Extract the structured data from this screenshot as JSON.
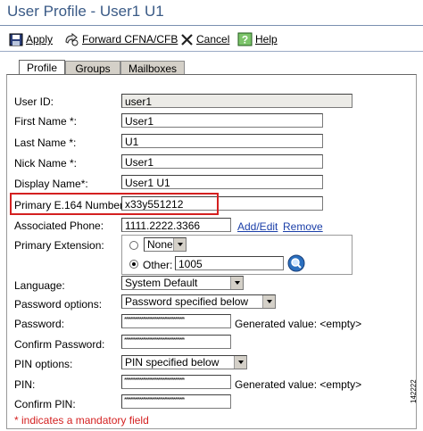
{
  "page": {
    "title": "User Profile - User1 U1"
  },
  "toolbar": {
    "apply": "Apply",
    "forward": "Forward CFNA/CFB",
    "cancel": "Cancel",
    "help": "Help"
  },
  "tabs": [
    "Profile",
    "Groups",
    "Mailboxes"
  ],
  "form": {
    "user_id": {
      "label": "User ID:",
      "value": "user1"
    },
    "first_name": {
      "label": "First Name *:",
      "value": "User1"
    },
    "last_name": {
      "label": "Last Name *:",
      "value": "U1"
    },
    "nick_name": {
      "label": "Nick Name *:",
      "value": "User1"
    },
    "display_name": {
      "label": "Display Name*:",
      "value": "User1 U1"
    },
    "primary_e164": {
      "label": "Primary E.164 Number:",
      "value": "x33y551212"
    },
    "associated_phone": {
      "label": "Associated Phone:",
      "value": "1111.2222.3366",
      "add_edit": "Add/Edit",
      "remove": "Remove"
    },
    "primary_extension": {
      "label": "Primary Extension:",
      "none_option": "None",
      "other_label": "Other:",
      "other_value": "1005"
    },
    "language": {
      "label": "Language:",
      "value": "System Default"
    },
    "password_options": {
      "label": "Password options:",
      "value": "Password specified below"
    },
    "password": {
      "label": "Password:",
      "mask": "***************************************",
      "generated": "Generated value: <empty>"
    },
    "confirm_password": {
      "label": "Confirm Password:",
      "mask": "***************************************"
    },
    "pin_options": {
      "label": "PIN options:",
      "value": "PIN specified below"
    },
    "pin": {
      "label": "PIN:",
      "mask": "***************************************",
      "generated": "Generated value: <empty>"
    },
    "confirm_pin": {
      "label": "Confirm PIN:",
      "mask": "***************************************"
    }
  },
  "footer": {
    "mandatory_note": "* indicates a mandatory field",
    "figure_id": "142222"
  },
  "colors": {
    "title": "#3a5a86",
    "link": "#1b3fa8",
    "highlight_box": "#d42020",
    "tab_bg": "#d4d0c8"
  }
}
